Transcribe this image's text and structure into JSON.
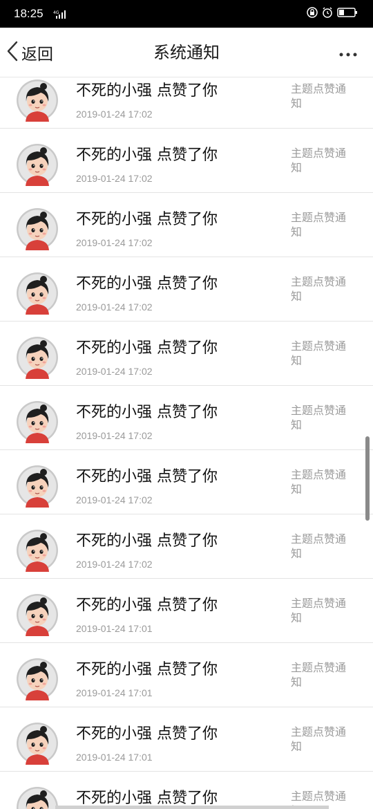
{
  "status_bar": {
    "time": "18:25",
    "network_label": "4G",
    "icons": [
      "network-signal-icon",
      "lock-icon",
      "alarm-icon",
      "battery-icon"
    ]
  },
  "nav": {
    "back_label": "返回",
    "title": "系统通知",
    "more_icon": "more-icon"
  },
  "notifications": [
    {
      "title": "不死的小强 点赞了你",
      "time": "2019-01-24 17:02",
      "type": "主题点赞通知"
    },
    {
      "title": "不死的小强 点赞了你",
      "time": "2019-01-24 17:02",
      "type": "主题点赞通知"
    },
    {
      "title": "不死的小强 点赞了你",
      "time": "2019-01-24 17:02",
      "type": "主题点赞通知"
    },
    {
      "title": "不死的小强 点赞了你",
      "time": "2019-01-24 17:02",
      "type": "主题点赞通知"
    },
    {
      "title": "不死的小强 点赞了你",
      "time": "2019-01-24 17:02",
      "type": "主题点赞通知"
    },
    {
      "title": "不死的小强 点赞了你",
      "time": "2019-01-24 17:02",
      "type": "主题点赞通知"
    },
    {
      "title": "不死的小强 点赞了你",
      "time": "2019-01-24 17:02",
      "type": "主题点赞通知"
    },
    {
      "title": "不死的小强 点赞了你",
      "time": "2019-01-24 17:02",
      "type": "主题点赞通知"
    },
    {
      "title": "不死的小强 点赞了你",
      "time": "2019-01-24 17:01",
      "type": "主题点赞通知"
    },
    {
      "title": "不死的小强 点赞了你",
      "time": "2019-01-24 17:01",
      "type": "主题点赞通知"
    },
    {
      "title": "不死的小强 点赞了你",
      "time": "2019-01-24 17:01",
      "type": "主题点赞通知"
    },
    {
      "title": "不死的小强 点赞了你",
      "time": "",
      "type": "主题点赞通知"
    }
  ],
  "colors": {
    "status_bar_bg": "#000000",
    "text_primary": "#111111",
    "text_secondary": "#9a9a9a",
    "divider": "#e3e3e3"
  }
}
